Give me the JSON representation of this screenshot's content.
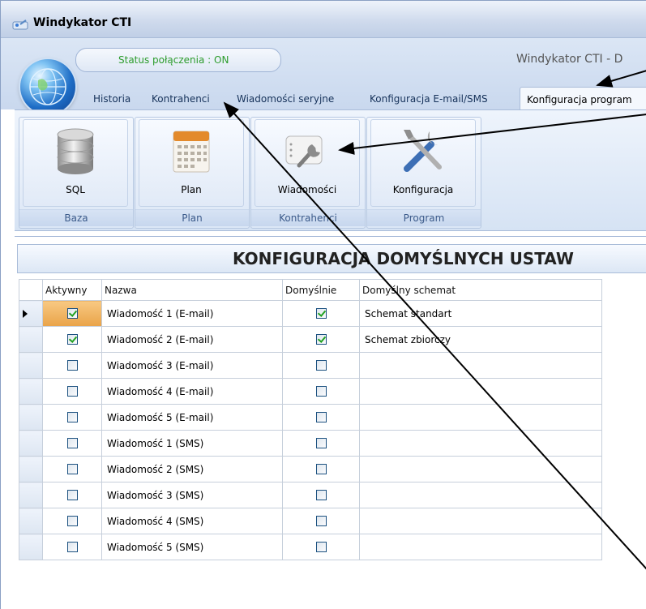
{
  "window": {
    "title": "Windykator CTI",
    "caption": "Windykator CTI  - D"
  },
  "status": {
    "text": "Status połączenia : ON",
    "color": "#2c9c2c"
  },
  "tabs": [
    {
      "label": "Historia"
    },
    {
      "label": "Kontrahenci"
    },
    {
      "label": "Wiadomości seryjne"
    },
    {
      "label": "Konfiguracja E-mail/SMS"
    },
    {
      "label": "Konfiguracja program"
    }
  ],
  "ribbon": {
    "groups": [
      {
        "button": "SQL",
        "label": "Baza",
        "icon": "database-icon"
      },
      {
        "button": "Plan",
        "label": "Plan",
        "icon": "calendar-icon"
      },
      {
        "button": "Wiadomości",
        "label": "Kontrahenci",
        "icon": "message-icon"
      },
      {
        "button": "Konfiguracja",
        "label": "Program",
        "icon": "tools-icon"
      }
    ]
  },
  "panel": {
    "title": "KONFIGURACJA DOMYŚLNYCH USTAW"
  },
  "grid": {
    "columns": [
      "Aktywny",
      "Nazwa",
      "Domyślnie",
      "Domyślny schemat"
    ],
    "rows": [
      {
        "active": true,
        "name": "Wiadomość 1 (E-mail)",
        "default": true,
        "schema": "Schemat standart"
      },
      {
        "active": true,
        "name": "Wiadomość 2 (E-mail)",
        "default": true,
        "schema": "Schemat zbiorczy"
      },
      {
        "active": false,
        "name": "Wiadomość 3 (E-mail)",
        "default": false,
        "schema": ""
      },
      {
        "active": false,
        "name": "Wiadomość 4 (E-mail)",
        "default": false,
        "schema": ""
      },
      {
        "active": false,
        "name": "Wiadomość 5 (E-mail)",
        "default": false,
        "schema": ""
      },
      {
        "active": false,
        "name": "Wiadomość 1 (SMS)",
        "default": false,
        "schema": ""
      },
      {
        "active": false,
        "name": "Wiadomość 2 (SMS)",
        "default": false,
        "schema": ""
      },
      {
        "active": false,
        "name": "Wiadomość 3 (SMS)",
        "default": false,
        "schema": ""
      },
      {
        "active": false,
        "name": "Wiadomość 4 (SMS)",
        "default": false,
        "schema": ""
      },
      {
        "active": false,
        "name": "Wiadomość 5 (SMS)",
        "default": false,
        "schema": ""
      }
    ]
  }
}
